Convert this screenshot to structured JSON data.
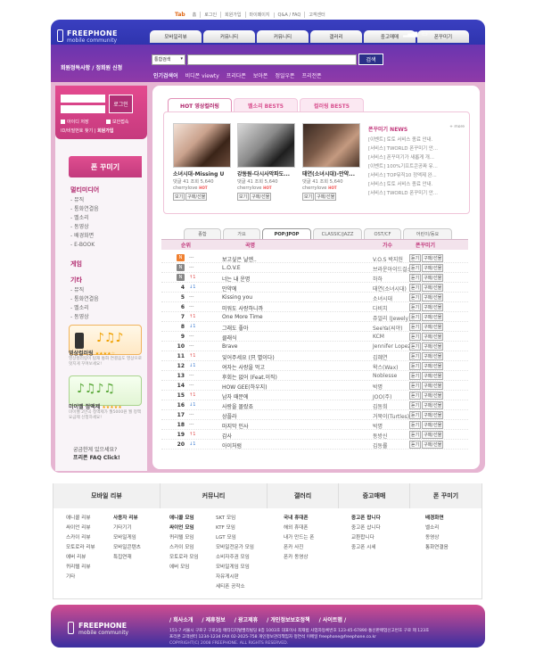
{
  "util": {
    "logo": "Tab",
    "items": [
      "홈",
      "로그인",
      "회원가입",
      "마이페이지",
      "Q&A / FAQ",
      "고객센터"
    ]
  },
  "brand": {
    "name": "FREEPHONE",
    "sub": "mobile community"
  },
  "nav": {
    "tabs": [
      "모바일리뷰",
      "커뮤니티",
      "커뮤니티",
      "갤러리",
      "중고매매",
      "폰꾸미기"
    ]
  },
  "member": {
    "links": "회원정독사항 / 정회원 신청"
  },
  "search": {
    "select": "통합검색",
    "button": "검색"
  },
  "popular": {
    "label": "인기검색어",
    "keywords": [
      "비디폰 viewty",
      "프리다폰",
      "보아폰",
      "정일우폰",
      "프리전폰"
    ]
  },
  "login": {
    "button": "로그인",
    "save_id": "아이디 저장",
    "secure": "보안접속",
    "find": "ID/비밀번호 찾기",
    "join": "회원가입"
  },
  "left": {
    "title": "폰 꾸미기",
    "sections": [
      {
        "head": "멀티미디어",
        "items": [
          "- 뮤직",
          "- 통화연결음",
          "- 벨소리",
          "- 동영상",
          "- 배경화면",
          "- E-BOOK"
        ]
      },
      {
        "head": "게임",
        "items": []
      },
      {
        "head": "기타",
        "items": [
          "- 뮤직",
          "- 통화연결음",
          "- 벨소리",
          "- 동영상"
        ]
      }
    ],
    "promo1": {
      "title": "영상컬러링",
      "stars": "★★★★☆",
      "desc": "영상컬러링이 탑재 통화 연결음도 영상으로 멋지게 꾸며보세요!"
    },
    "promo2": {
      "title": "미이벨 정액제",
      "stars": "★★★★★",
      "desc": "미이벨 2만곡 정액제가 월5000원 월 정액 요금제 신청하세요!"
    },
    "faq": {
      "line1": "궁금한게 있으세요?",
      "line2": "프리폰 FAQ Click!"
    }
  },
  "hot_tabs": [
    "HOT 영상컬러링",
    "벨소리 BEST5",
    "컬러링 BEST5"
  ],
  "cards": [
    {
      "title": "소녀시대-Missing U",
      "stats": "댓글 41 조회 5,640",
      "user": "cherrylove",
      "hot": "HOT",
      "b1": "보기",
      "b2": "구매/선물"
    },
    {
      "title": "강동원-다시사막파도...",
      "stats": "댓글 41 조회 5,640",
      "user": "cherrylove",
      "hot": "HOT",
      "b1": "보기",
      "b2": "구매/선물"
    },
    {
      "title": "태연(소녀시대)-만약...",
      "stats": "댓글 41 조회 5,640",
      "user": "cherrylove",
      "hot": "HOT",
      "b1": "보기",
      "b2": "구매/선물"
    }
  ],
  "news": {
    "title": "폰꾸미기 NEWS",
    "more": "+ more",
    "items": [
      "[이벤트] 토토 서비스 종료 안내.",
      "[서비스] TWORLD 폰꾸미기 안...",
      "[서비스] 폰꾸미기가 새롭게 개...",
      "[이벤트] 100%기프트콘공짜 유...",
      "[서비스] TOP뮤직10 정액제 완...",
      "[서비스] 토토 서비스 종료 안내.",
      "[서비스] TWORLD 폰꾸미기 안..."
    ]
  },
  "chart_tabs": [
    "종합",
    "가요",
    "POP/JPOP",
    "CLASSIC/JAZZ",
    "OST/CF",
    "어린이/동요"
  ],
  "table": {
    "headers": {
      "rank": "순위",
      "title": "곡명",
      "singer": "가수",
      "action": "폰꾸미기"
    },
    "btn_listen": "듣기",
    "btn_buy": "구매/선물",
    "rows": [
      {
        "rank": "1",
        "mark": "N",
        "change": "---",
        "dir": "same",
        "title": "보고싶은 날엔..",
        "singer": "V.O.S 박지헌"
      },
      {
        "rank": "2",
        "mark": "N",
        "change": "---",
        "dir": "same",
        "title": "L.O.V.E",
        "singer": "브라운아이드걸스"
      },
      {
        "rank": "3",
        "mark": "N",
        "change": "↑1",
        "dir": "up",
        "title": "너는 내 운명",
        "singer": "하하"
      },
      {
        "rank": "4",
        "mark": "",
        "change": "↓1",
        "dir": "down",
        "title": "만약에",
        "singer": "태연(소녀시대)"
      },
      {
        "rank": "5",
        "mark": "",
        "change": "---",
        "dir": "same",
        "title": "Kissing you",
        "singer": "소녀시대"
      },
      {
        "rank": "6",
        "mark": "",
        "change": "---",
        "dir": "same",
        "title": "미워도 사랑하니까",
        "singer": "다비치"
      },
      {
        "rank": "7",
        "mark": "",
        "change": "↑1",
        "dir": "up",
        "title": "One More Time",
        "singer": "쥬얼리 (Jewely)"
      },
      {
        "rank": "8",
        "mark": "",
        "change": "↓1",
        "dir": "down",
        "title": "그래도 좋아",
        "singer": "SeeYa(씨야)"
      },
      {
        "rank": "9",
        "mark": "",
        "change": "---",
        "dir": "same",
        "title": "클래식",
        "singer": "KCM"
      },
      {
        "rank": "10",
        "mark": "",
        "change": "---",
        "dir": "same",
        "title": "Brave",
        "singer": "Jennifer Lopez"
      },
      {
        "rank": "11",
        "mark": "",
        "change": "↑1",
        "dir": "up",
        "title": "잊어주세요 (只 별이다)",
        "singer": "김혜연"
      },
      {
        "rank": "12",
        "mark": "",
        "change": "↓1",
        "dir": "down",
        "title": "여자는 사랑을 먹고",
        "singer": "왁스(Wax)"
      },
      {
        "rank": "13",
        "mark": "",
        "change": "---",
        "dir": "same",
        "title": "후회는 없어 (Feat.이직)",
        "singer": "Noblesse"
      },
      {
        "rank": "14",
        "mark": "",
        "change": "---",
        "dir": "same",
        "title": "HOW GEE(하우지)",
        "singer": "박명"
      },
      {
        "rank": "15",
        "mark": "",
        "change": "↑1",
        "dir": "up",
        "title": "남자 때문에",
        "singer": "JOO(주)"
      },
      {
        "rank": "16",
        "mark": "",
        "change": "↓1",
        "dir": "down",
        "title": "사랑을 몰랐죠",
        "singer": "김동희"
      },
      {
        "rank": "17",
        "mark": "",
        "change": "---",
        "dir": "same",
        "title": "상플라",
        "singer": "거북이(Turtles)"
      },
      {
        "rank": "18",
        "mark": "",
        "change": "---",
        "dir": "same",
        "title": "마지막 인사",
        "singer": "박명"
      },
      {
        "rank": "19",
        "mark": "",
        "change": "↑1",
        "dir": "up",
        "title": "감사",
        "singer": "동방신"
      },
      {
        "rank": "20",
        "mark": "",
        "change": "↓1",
        "dir": "down",
        "title": "아이처럼",
        "singer": "김동률"
      }
    ]
  },
  "footer_nav": {
    "heads": [
      "모바일 리뷰",
      "커뮤니티",
      "갤러리",
      "중고매매",
      "폰 꾸미기"
    ],
    "col1": [
      "애니콜 리뷰",
      "싸이언 리뷰",
      "스카이 리뷰",
      "모토로라 리뷰",
      "에버 리뷰",
      "퀴리텔 리뷰",
      "기타"
    ],
    "col1b": [
      "사용자 리뷰",
      "기타기기",
      "모바일게임",
      "모바일콘텐츠",
      "특집연재"
    ],
    "col2": [
      "애니콜 모임",
      "싸이언 모임",
      "퀴리텔 모임",
      "스카이 모임",
      "모토로라 모임",
      "에버 모임"
    ],
    "col2b": [
      "SKT 모임",
      "KTF 모임",
      "LGT 모임",
      "모바일전문가 모임",
      "소비자주권 모임",
      "모바일게임 모임",
      "자유게시판",
      "세티폰 공작소"
    ],
    "col3": [
      "국내 휴대폰",
      "해외 휴대폰",
      "내가 만드는 폰",
      "폰카 사진",
      "폰카 동영상"
    ],
    "col4": [
      "중고폰 팝니다",
      "중고폰 삽니다",
      "교환합니다",
      "중고폰 시세"
    ],
    "col5": [
      "배경화면",
      "벨소리",
      "동영상",
      "통화연결음"
    ],
    "new_mark": "N"
  },
  "footer": {
    "links": [
      "/ 회사소개",
      "/ 제휴정보",
      "/ 광고제휴",
      "/ 개인정보보호정책",
      "/ 사이트맵 /"
    ],
    "addr1": "151-7 서울시 구로구 구로3동 메타디지털밸리빌딩 8층 1003호   대표이사 최재범   사업자등록번호 123-45-67890   통신판매업신고번호 구로 제 123호",
    "addr2": "프리폰 고객센터 1234-1234   FAX 02-2025-758   개인정보관리책임자 정연석   이메일 freephone@freephone.co.kr",
    "copy": "COPYRIGHT(C) 2008 FREEPHONE. ALL RIGHTS RESERVED."
  }
}
